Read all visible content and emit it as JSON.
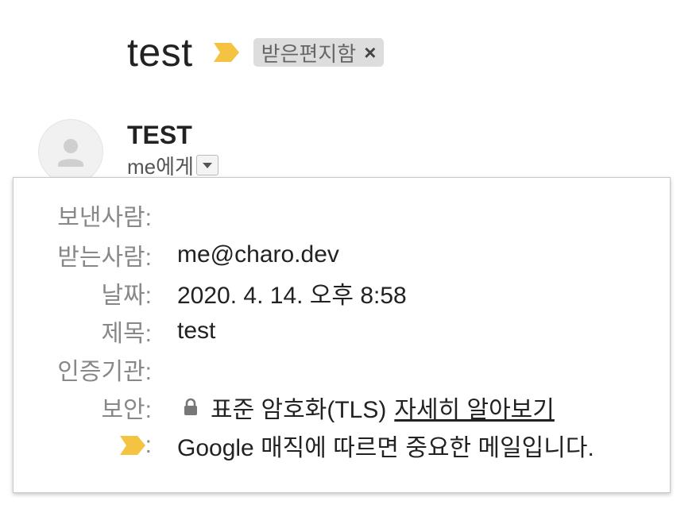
{
  "subject": {
    "title": "test",
    "label_chip": "받은편지함",
    "label_remove": "×"
  },
  "sender": {
    "name": "TEST",
    "recipient_summary": "me에게"
  },
  "details": {
    "from_label": "보낸사람:",
    "from_value": "",
    "to_label": "받는사람:",
    "to_value": "me@charo.dev",
    "date_label": "날짜:",
    "date_value": "2020. 4. 14. 오후 8:58",
    "subject_label": "제목:",
    "subject_value": "test",
    "signed_by_label": "인증기관:",
    "signed_by_value": "",
    "security_label": "보안:",
    "security_value": "표준 암호화(TLS)",
    "security_link": "자세히 알아보기",
    "importance_colon": ":",
    "importance_value": "Google 매직에 따르면 중요한 메일입니다."
  },
  "icons": {
    "importance_marker": "importance-marker-icon",
    "avatar": "person-avatar-icon",
    "dropdown": "caret-down-icon",
    "lock": "lock-icon"
  },
  "colors": {
    "importance_yellow": "#f5c342",
    "chip_bg": "#dddddd",
    "label_gray": "#888888",
    "text": "#222222"
  }
}
